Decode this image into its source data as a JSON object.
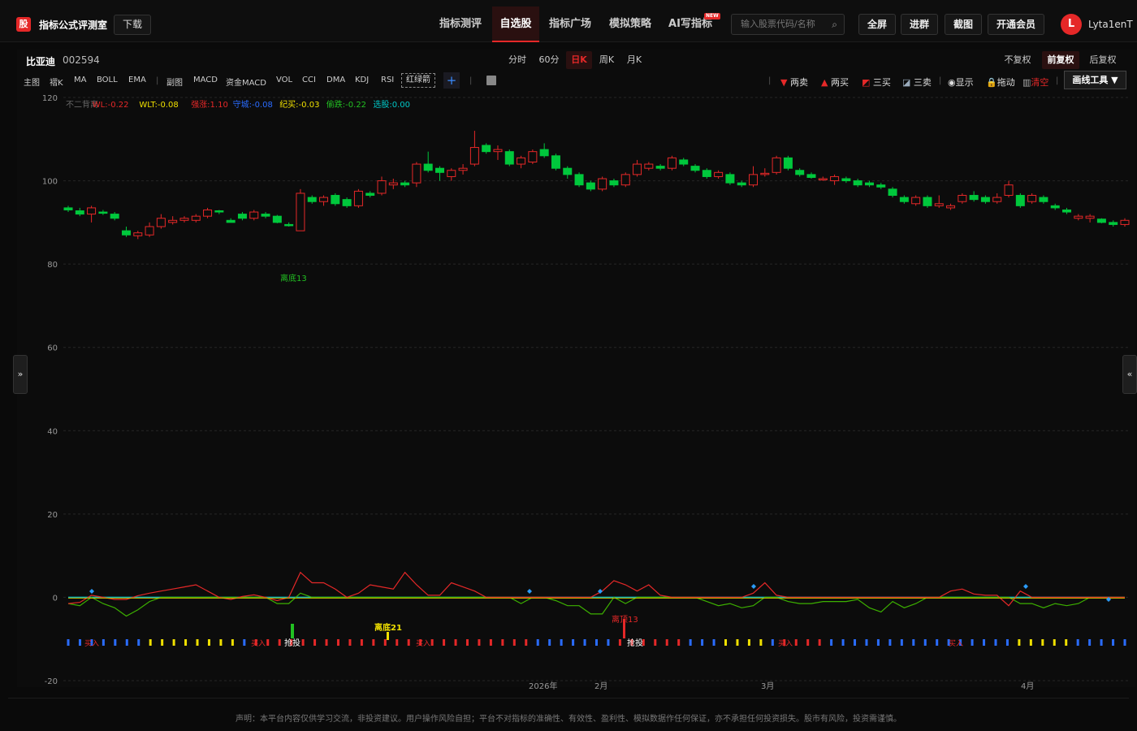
{
  "app": {
    "logo_text": "股",
    "brand": "指标公式评测室",
    "download": "下载"
  },
  "nav": [
    {
      "label": "指标测评"
    },
    {
      "label": "自选股"
    },
    {
      "label": "指标广场"
    },
    {
      "label": "模拟策略"
    },
    {
      "label": "AI写指标"
    }
  ],
  "new_badge": "NEW",
  "search": {
    "placeholder": "输入股票代码/名称"
  },
  "top_buttons": {
    "fullscreen": "全屏",
    "join_group": "进群",
    "screenshot": "截图",
    "vip": "开通会员"
  },
  "user": {
    "avatar_letter": "L",
    "name": "Lyta1enT"
  },
  "stock": {
    "name": "比亚迪",
    "code": "002594"
  },
  "periods": [
    "分时",
    "60分",
    "日K",
    "周K",
    "月K"
  ],
  "active_period": "日K",
  "adjust": [
    "不复权",
    "前复权",
    "后复权"
  ],
  "active_adjust": "前复权",
  "indicators_left": [
    "主图",
    "褶K",
    "MA",
    "BOLL",
    "EMA"
  ],
  "indicators_right": [
    "副图",
    "MACD",
    "资金MACD",
    "VOL",
    "CCI",
    "DMA",
    "KDJ",
    "RSI"
  ],
  "red_green_btn": "红绿箭",
  "tools": {
    "sell2": "两卖",
    "buy2": "两买",
    "buy3": "三买",
    "sell3": "三卖",
    "show": "显示",
    "drag": "拖动",
    "clear": "清空",
    "draw_tool": "画线工具 ▼"
  },
  "side_tabs": {
    "left": "»",
    "right": "«"
  },
  "legend": [
    {
      "text": "不二背离",
      "color": "#666666"
    },
    {
      "text": "WL:-0.22",
      "color": "#e52828"
    },
    {
      "text": "WLT:-0.08",
      "color": "#f0e000"
    },
    {
      "text": "强涨:1.10",
      "color": "#e52828"
    },
    {
      "text": "守城:-0.08",
      "color": "#2a6cff"
    },
    {
      "text": "纪买:-0.03",
      "color": "#f0e000"
    },
    {
      "text": "偷跌:-0.22",
      "color": "#22c022"
    },
    {
      "text": "选股:0.00",
      "color": "#00c8c8"
    }
  ],
  "annotations": {
    "a1": "离底13",
    "a2": "离底21",
    "a3": "离顶13",
    "buy_small": "买入",
    "grab": "抢投"
  },
  "x_axis_labels": [
    "2026年",
    "2月",
    "3月",
    "4月"
  ],
  "footer": "声明：本平台内容仅供学习交流，非投资建议。用户操作风险自担；平台不对指标的准确性、有效性、盈利性、模拟数据作任何保证，亦不承担任何投资损失。股市有风险，投资需谨慎。",
  "colors": {
    "up": "#e52828",
    "down": "#00c83c",
    "accent": "#e52828",
    "grid": "#2a2a2a"
  },
  "chart_data": {
    "type": "candlestick",
    "title": "",
    "ylim": [
      -20,
      120
    ],
    "y_ticks": [
      120,
      100,
      80,
      60,
      40,
      20,
      0,
      -20
    ],
    "grid": true,
    "candles": [
      [
        93.5,
        93.0,
        94.0,
        92.5
      ],
      [
        92.8,
        92.0,
        93.5,
        91.5
      ],
      [
        92.0,
        93.5,
        94.0,
        90.0
      ],
      [
        92.5,
        92.2,
        93.0,
        91.8
      ],
      [
        92.0,
        91.0,
        92.5,
        90.5
      ],
      [
        88.0,
        87.0,
        89.0,
        86.5
      ],
      [
        86.8,
        87.5,
        88.0,
        86.0
      ],
      [
        87.0,
        89.0,
        90.0,
        86.5
      ],
      [
        89.0,
        91.0,
        92.0,
        88.5
      ],
      [
        90.0,
        90.5,
        91.5,
        89.5
      ],
      [
        90.5,
        91.0,
        91.5,
        90.0
      ],
      [
        90.5,
        91.5,
        92.0,
        90.0
      ],
      [
        91.5,
        93.0,
        93.5,
        91.0
      ],
      [
        92.8,
        92.5,
        93.0,
        92.0
      ],
      [
        90.5,
        90.0,
        91.0,
        90.0
      ],
      [
        92.0,
        91.0,
        92.5,
        90.5
      ],
      [
        91.0,
        92.5,
        93.0,
        90.5
      ],
      [
        92.0,
        91.5,
        92.5,
        91.0
      ],
      [
        91.5,
        90.0,
        91.8,
        89.8
      ],
      [
        89.5,
        89.3,
        90.0,
        89.0
      ],
      [
        88.0,
        97.0,
        98.0,
        88.0
      ],
      [
        96.0,
        95.0,
        96.5,
        94.5
      ],
      [
        95.0,
        96.0,
        96.5,
        94.0
      ],
      [
        96.5,
        94.5,
        97.0,
        94.0
      ],
      [
        95.5,
        94.0,
        96.0,
        93.5
      ],
      [
        94.0,
        97.5,
        98.0,
        93.5
      ],
      [
        97.0,
        96.5,
        97.5,
        96.0
      ],
      [
        97.0,
        100.0,
        101.0,
        96.5
      ],
      [
        99.0,
        99.5,
        100.5,
        98.0
      ],
      [
        99.5,
        99.0,
        100.0,
        98.5
      ],
      [
        99.5,
        104.0,
        104.5,
        98.5
      ],
      [
        104.0,
        102.5,
        107.0,
        102.0
      ],
      [
        103.0,
        102.0,
        103.5,
        100.0
      ],
      [
        101.0,
        102.5,
        103.0,
        100.0
      ],
      [
        102.5,
        103.0,
        104.0,
        101.5
      ],
      [
        104.0,
        108.0,
        112.0,
        103.5
      ],
      [
        108.5,
        107.0,
        109.0,
        106.5
      ],
      [
        107.0,
        107.5,
        108.5,
        105.0
      ],
      [
        107.0,
        104.0,
        107.5,
        103.5
      ],
      [
        104.0,
        105.5,
        106.0,
        103.0
      ],
      [
        104.5,
        107.0,
        107.5,
        104.0
      ],
      [
        107.5,
        106.0,
        109.0,
        105.5
      ],
      [
        106.0,
        103.0,
        106.5,
        102.5
      ],
      [
        103.0,
        101.5,
        103.5,
        100.5
      ],
      [
        101.5,
        99.0,
        102.0,
        98.5
      ],
      [
        99.5,
        98.0,
        100.0,
        97.5
      ],
      [
        98.0,
        100.5,
        101.0,
        97.5
      ],
      [
        100.0,
        99.0,
        100.5,
        98.5
      ],
      [
        99.0,
        101.5,
        102.0,
        98.5
      ],
      [
        101.5,
        104.0,
        105.0,
        101.0
      ],
      [
        103.0,
        104.0,
        104.5,
        102.5
      ],
      [
        103.5,
        103.0,
        104.0,
        102.5
      ],
      [
        103.0,
        105.5,
        106.0,
        102.5
      ],
      [
        105.0,
        104.0,
        105.5,
        103.5
      ],
      [
        103.5,
        102.5,
        104.0,
        102.0
      ],
      [
        102.5,
        101.0,
        103.0,
        100.5
      ],
      [
        101.0,
        102.0,
        102.5,
        100.5
      ],
      [
        101.5,
        99.5,
        102.0,
        99.0
      ],
      [
        99.5,
        99.0,
        100.0,
        98.5
      ],
      [
        99.0,
        101.5,
        103.5,
        98.5
      ],
      [
        101.5,
        101.8,
        103.0,
        101.0
      ],
      [
        102.0,
        105.5,
        106.0,
        101.5
      ],
      [
        105.5,
        103.0,
        106.0,
        102.5
      ],
      [
        102.5,
        101.5,
        103.0,
        101.0
      ],
      [
        101.5,
        100.8,
        102.0,
        100.5
      ],
      [
        100.5,
        100.5,
        101.0,
        100.0
      ],
      [
        100.0,
        101.0,
        101.5,
        99.0
      ],
      [
        100.5,
        100.0,
        101.0,
        99.5
      ],
      [
        100.0,
        99.0,
        100.5,
        98.5
      ],
      [
        99.5,
        99.0,
        100.0,
        98.5
      ],
      [
        99.0,
        98.5,
        99.5,
        98.0
      ],
      [
        98.0,
        96.5,
        98.5,
        96.0
      ],
      [
        96.0,
        95.0,
        96.5,
        94.5
      ],
      [
        94.5,
        96.0,
        96.5,
        94.0
      ],
      [
        96.0,
        94.0,
        96.5,
        93.5
      ],
      [
        94.0,
        94.5,
        96.5,
        93.5
      ],
      [
        93.5,
        94.0,
        94.5,
        93.0
      ],
      [
        95.0,
        96.5,
        97.0,
        94.5
      ],
      [
        96.5,
        95.5,
        97.5,
        95.0
      ],
      [
        96.0,
        95.0,
        96.5,
        94.5
      ],
      [
        95.0,
        96.0,
        97.0,
        94.5
      ],
      [
        96.5,
        99.0,
        100.0,
        96.0
      ],
      [
        96.5,
        94.0,
        97.0,
        93.5
      ],
      [
        95.0,
        96.5,
        97.0,
        94.5
      ],
      [
        96.0,
        95.0,
        96.5,
        94.5
      ],
      [
        94.0,
        93.5,
        94.5,
        93.0
      ],
      [
        93.0,
        92.5,
        93.5,
        92.0
      ],
      [
        91.0,
        91.5,
        92.0,
        90.5
      ],
      [
        91.0,
        91.5,
        92.0,
        90.0
      ],
      [
        90.8,
        90.0,
        91.0,
        89.8
      ],
      [
        90.0,
        89.5,
        90.5,
        89.0
      ],
      [
        89.5,
        90.5,
        91.0,
        89.0
      ]
    ],
    "sub_series": {
      "red": [
        -1.5,
        -1.2,
        0.5,
        0,
        -0.5,
        -0.5,
        0.4,
        1,
        1.5,
        2,
        2.5,
        3,
        1.5,
        0,
        -0.5,
        0.2,
        0.6,
        0,
        -0.8,
        0,
        6,
        3.5,
        3.5,
        2,
        0,
        1,
        3,
        2.5,
        2,
        6,
        3,
        0.5,
        0.5,
        3.5,
        2.5,
        1.5,
        0,
        0,
        0,
        0,
        0,
        0,
        0,
        0,
        0,
        0,
        1.5,
        4,
        3,
        1.5,
        3,
        0.5,
        0,
        0,
        0,
        0,
        0,
        0,
        0,
        1,
        3.5,
        0.5,
        0,
        0,
        0,
        0,
        0,
        0,
        0,
        0,
        0,
        0,
        0,
        0,
        0,
        0,
        1.5,
        2,
        0.8,
        0.5,
        0.5,
        -2,
        1.5,
        0,
        0,
        0,
        0,
        0,
        0,
        0,
        0,
        0
      ],
      "green": [
        -1.5,
        -2,
        0,
        -1.5,
        -2.5,
        -4.5,
        -3,
        -1,
        0,
        0,
        0,
        0,
        0,
        0,
        0,
        0,
        0,
        0,
        -1.5,
        -1.5,
        1,
        0,
        0,
        0,
        0,
        0,
        0,
        0,
        0,
        0,
        0,
        0,
        0,
        0,
        0,
        0,
        0,
        0,
        0,
        -1.5,
        0,
        0,
        -0.8,
        -2,
        -2,
        -4,
        -4,
        0,
        -1.5,
        0,
        0,
        0,
        0,
        0,
        0,
        -1,
        -2,
        -1.5,
        -2.5,
        -2,
        0,
        0,
        -1,
        -1.5,
        -1.5,
        -1,
        -1,
        -1,
        -0.5,
        -2.5,
        -3.5,
        -1,
        -2.5,
        -1.5,
        0,
        0,
        0,
        0,
        0,
        0,
        0,
        0,
        -1.5,
        -1.5,
        -2.5,
        -1.5,
        -2,
        -1.5,
        0,
        0,
        0,
        0
      ],
      "cyan": 0
    }
  }
}
